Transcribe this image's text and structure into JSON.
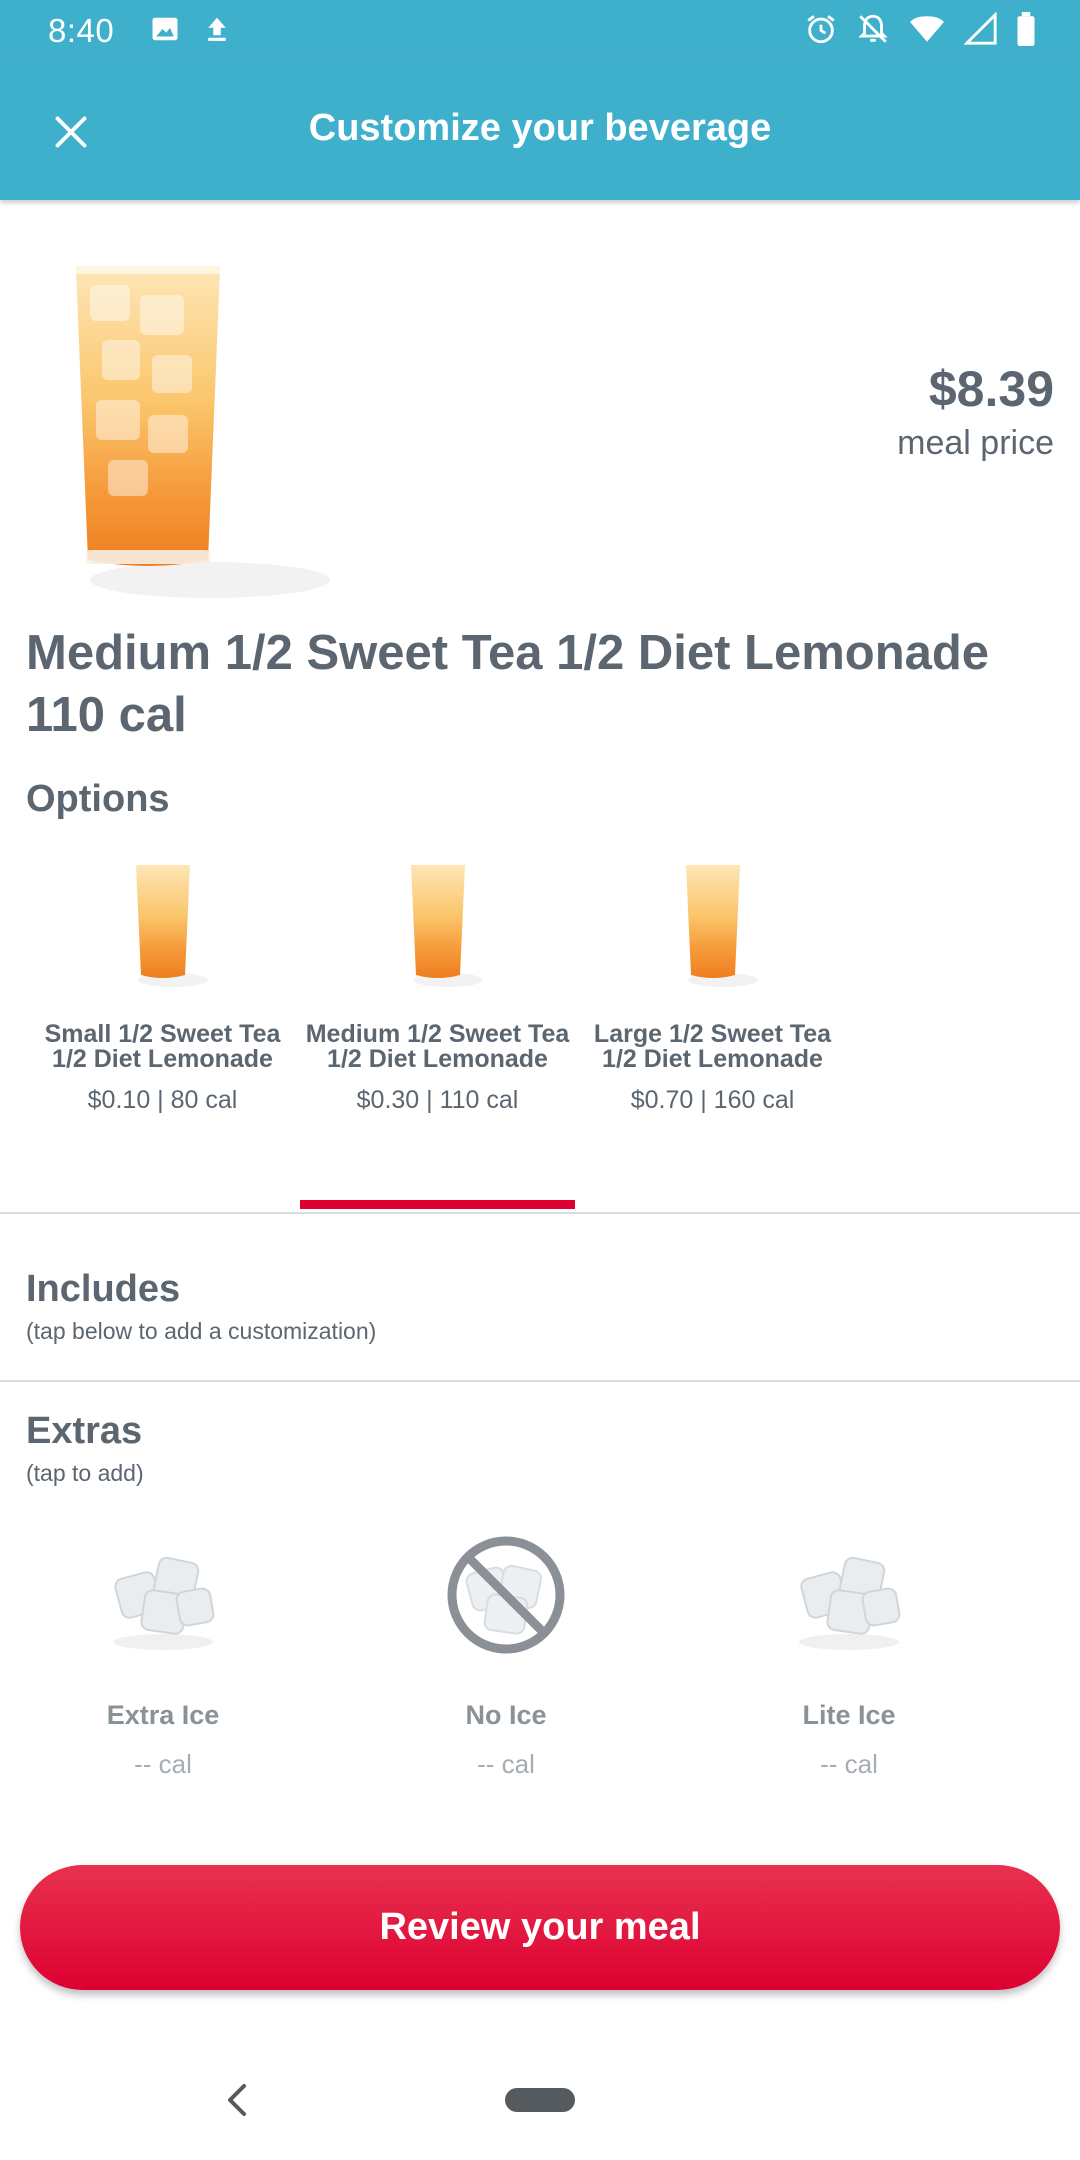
{
  "status_bar": {
    "time": "8:40",
    "left_icons": [
      "image-icon",
      "upload-icon"
    ],
    "right_icons": [
      "alarm-icon",
      "bell-off-icon",
      "wifi-icon",
      "signal-icon",
      "battery-icon"
    ]
  },
  "app_bar": {
    "close_icon": "close-icon",
    "title": "Customize your beverage"
  },
  "hero": {
    "price": "$8.39",
    "price_label": "meal price",
    "title": "Medium 1/2 Sweet Tea 1/2 Diet Lemonade 110 cal"
  },
  "options": {
    "heading": "Options",
    "items": [
      {
        "name": "Small 1/2 Sweet Tea 1/2 Diet Lemonade",
        "meta": "$0.10 | 80 cal",
        "selected": false
      },
      {
        "name": "Medium 1/2 Sweet Tea 1/2 Diet Lemonade",
        "meta": "$0.30 | 110 cal",
        "selected": true
      },
      {
        "name": "Large 1/2 Sweet Tea 1/2 Diet Lemonade",
        "meta": "$0.70 | 160 cal",
        "selected": false
      }
    ]
  },
  "includes": {
    "heading": "Includes",
    "subtitle": "(tap below to add a customization)"
  },
  "extras": {
    "heading": "Extras",
    "subtitle": "(tap to add)",
    "items": [
      {
        "name": "Extra Ice",
        "cal": "-- cal",
        "icon": "ice-icon"
      },
      {
        "name": "No Ice",
        "cal": "-- cal",
        "icon": "no-ice-icon"
      },
      {
        "name": "Lite Ice",
        "cal": "-- cal",
        "icon": "ice-icon"
      }
    ]
  },
  "cta": {
    "label": "Review your meal"
  },
  "colors": {
    "app_bar": "#3fb0cb",
    "accent_red": "#dd0031",
    "text_gray": "#5b6670"
  }
}
